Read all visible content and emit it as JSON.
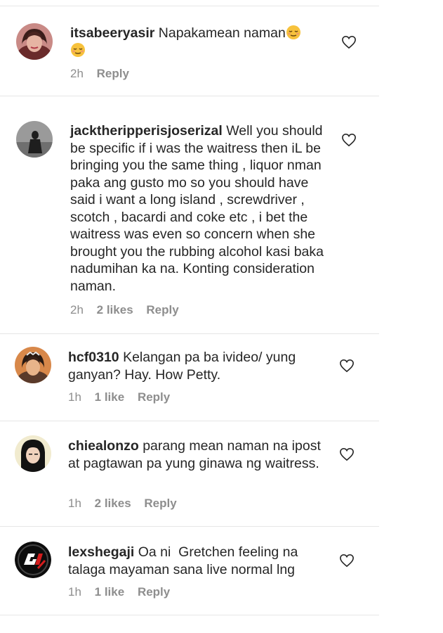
{
  "comments": [
    {
      "username": "itsabeeryasir",
      "text": "Napakamean naman",
      "emoji_icon": "relieved-face-icon",
      "time": "2h",
      "likes": "",
      "reply": "Reply"
    },
    {
      "username": "jacktheripperisjoserizal",
      "text": "Well you should be specific if i was the waitress then iL be bringing you the same thing , liquor nman paka ang gusto mo so you should have said i want a long island , screwdriver , scotch , bacardi and coke etc , i bet the waitress was even so concern when she brought you the rubbing alcohol kasi baka nadumihan ka na. Konting consideration naman.",
      "time": "2h",
      "likes": "2 likes",
      "reply": "Reply"
    },
    {
      "username": "hcf0310",
      "text": "Kelangan pa ba ivideo/ yung ganyan? Hay. How Petty.",
      "time": "1h",
      "likes": "1 like",
      "reply": "Reply"
    },
    {
      "username": "chiealonzo",
      "text": "parang mean naman na ipost at pagtawan pa yung ginawa ng waitress.",
      "time": "1h",
      "likes": "2 likes",
      "reply": "Reply"
    },
    {
      "username": "lexshegaji",
      "text": "Oa ni  Gretchen feeling na talaga mayaman sana live normal lng",
      "time": "1h",
      "likes": "1 like",
      "reply": "Reply"
    }
  ],
  "icons": {
    "like": "heart-outline-icon"
  },
  "colors": {
    "text": "#262626",
    "meta": "#8e8e8e",
    "divider": "#e6e6e6",
    "emoji": "#f7c23c"
  }
}
